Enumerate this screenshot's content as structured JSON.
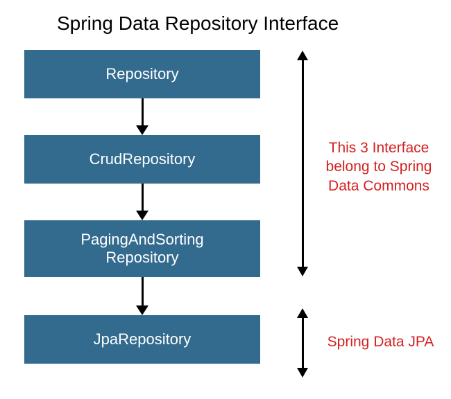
{
  "title": "Spring Data Repository Interface",
  "boxes": {
    "b1": "Repository",
    "b2": "CrudRepository",
    "b3": "PagingAndSorting\nRepository",
    "b4": "JpaRepository"
  },
  "annotations": {
    "commons": "This 3 Interface\nbelong to Spring\nData Commons",
    "jpa": "Spring Data JPA"
  }
}
